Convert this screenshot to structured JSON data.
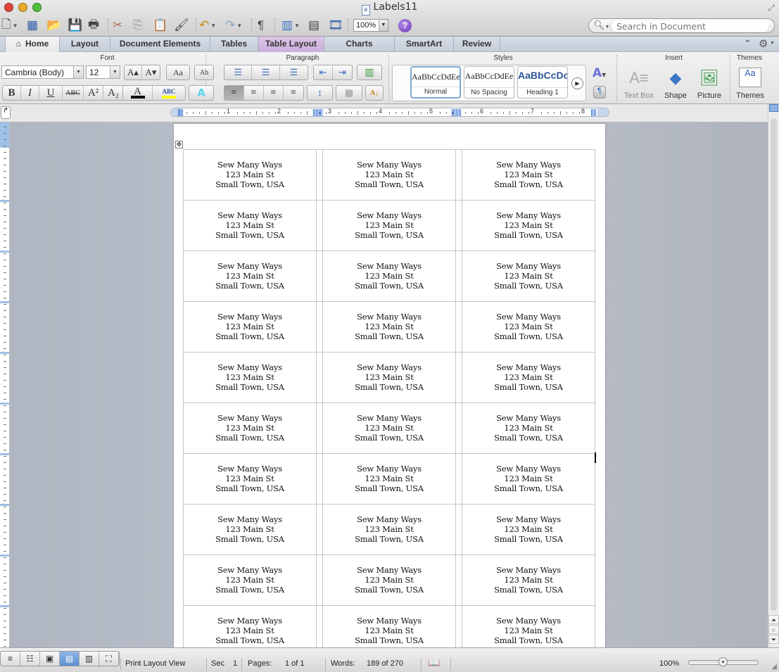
{
  "window": {
    "title": "Labels11",
    "doc_icon_glyph": "a",
    "traffic_lights": {
      "close": "#e0443e",
      "minimize": "#e8a92b",
      "maximize": "#4fbf3c"
    }
  },
  "toolbar": {
    "zoom_value": "100%",
    "buttons": [
      {
        "name": "new-document-icon",
        "glyph": "🗋"
      },
      {
        "name": "templates-gallery-icon",
        "glyph": "▦"
      },
      {
        "name": "open-folder-icon",
        "glyph": "📂"
      },
      {
        "name": "save-icon",
        "glyph": "💾"
      },
      {
        "name": "print-icon",
        "glyph": "🖶"
      },
      {
        "name": "cut-icon",
        "glyph": "✂"
      },
      {
        "name": "copy-icon",
        "glyph": "⎘"
      },
      {
        "name": "paste-icon",
        "glyph": "📋"
      },
      {
        "name": "format-painter-icon",
        "glyph": "🖌"
      },
      {
        "name": "undo-icon",
        "glyph": "↶"
      },
      {
        "name": "redo-icon",
        "glyph": "↷"
      },
      {
        "name": "show-formatting-icon",
        "glyph": "¶"
      },
      {
        "name": "sidebar-icon",
        "glyph": "▥"
      },
      {
        "name": "toolbox-icon",
        "glyph": "▤"
      },
      {
        "name": "media-browser-icon",
        "glyph": "🎞"
      }
    ],
    "help_glyph": "?",
    "search_placeholder": "Search in Document",
    "search_icon": "⚲"
  },
  "ribbon_tabs": [
    {
      "label": "Home",
      "icon": "⌂",
      "state": "active"
    },
    {
      "label": "Layout"
    },
    {
      "label": "Document Elements"
    },
    {
      "label": "Tables"
    },
    {
      "label": "Table Layout",
      "state": "contextual"
    },
    {
      "label": "Charts"
    },
    {
      "label": "SmartArt"
    },
    {
      "label": "Review"
    }
  ],
  "ribbon_controls": {
    "collapse_glyph": "⌃",
    "settings_glyph": "⚙"
  },
  "ribbon": {
    "groups": {
      "font": "Font",
      "paragraph": "Paragraph",
      "styles": "Styles",
      "insert": "Insert",
      "themes": "Themes"
    },
    "font": {
      "family": "Cambria (Body)",
      "size": "12",
      "grow_glyph": "A▴",
      "shrink_glyph": "A▾",
      "change_case_glyph": "Aa",
      "clear_glyph": "Ab",
      "bold": "B",
      "italic": "I",
      "underline": "U",
      "strikethrough": "ABC",
      "superscript": "A²",
      "subscript": "A₂",
      "font_color": "A",
      "font_color_swatch": "#000000",
      "highlight": "ABC",
      "highlight_swatch": "#ffff00",
      "text_effects": "A"
    },
    "paragraph": {
      "bullets": "☰",
      "numbering": "☰",
      "multilevel": "☰",
      "decrease_indent": "⇤",
      "increase_indent": "⇥",
      "columns": "▥",
      "align_left": "≡",
      "align_center": "≡",
      "align_right": "≡",
      "justify": "≡",
      "line_spacing": "↕",
      "borders": "▦",
      "sort": "A↓"
    },
    "styles": [
      {
        "sample": "AaBbCcDdEe",
        "name": "Normal",
        "selected": true
      },
      {
        "sample": "AaBbCcDdEe",
        "name": "No Spacing"
      },
      {
        "sample": "AaBbCcDc",
        "name": "Heading 1",
        "color": "#2f5597"
      }
    ],
    "styles_more_glyph": "▶",
    "insert": [
      {
        "label": "Text Box",
        "glyph": "A≡",
        "disabled": true
      },
      {
        "label": "Shape",
        "glyph": "◆"
      },
      {
        "label": "Picture",
        "glyph": "🖼"
      }
    ],
    "themes": {
      "label": "Themes",
      "glyph": "Aa"
    }
  },
  "ruler": {
    "numbers": [
      "1",
      "2",
      "3",
      "4",
      "5",
      "6",
      "7",
      "8"
    ],
    "tab_selector_glyph": "↱"
  },
  "document": {
    "label_lines": [
      "Sew Many Ways",
      "123 Main St",
      "Small Town, USA"
    ],
    "rows": 10,
    "columns": 3,
    "move_handle_glyph": "✥"
  },
  "scrollbar": {
    "prev_glyph": "⏶",
    "browse_glyph": "○",
    "next_glyph": "⏷"
  },
  "status": {
    "view_buttons": [
      {
        "name": "draft-view-button",
        "glyph": "≡"
      },
      {
        "name": "outline-view-button",
        "glyph": "☷"
      },
      {
        "name": "publishing-layout-button",
        "glyph": "▣"
      },
      {
        "name": "print-layout-button",
        "glyph": "▤",
        "active": true
      },
      {
        "name": "notebook-layout-button",
        "glyph": "▥"
      },
      {
        "name": "full-screen-button",
        "glyph": "⛶"
      }
    ],
    "view_name": "Print Layout View",
    "section_label": "Sec",
    "section_value": "1",
    "pages_label": "Pages:",
    "pages_value": "1 of 1",
    "words_label": "Words:",
    "words_value": "189 of 270",
    "proofing_glyph": "📖",
    "zoom": "100%",
    "zoom_slider_fraction": 0.5
  }
}
